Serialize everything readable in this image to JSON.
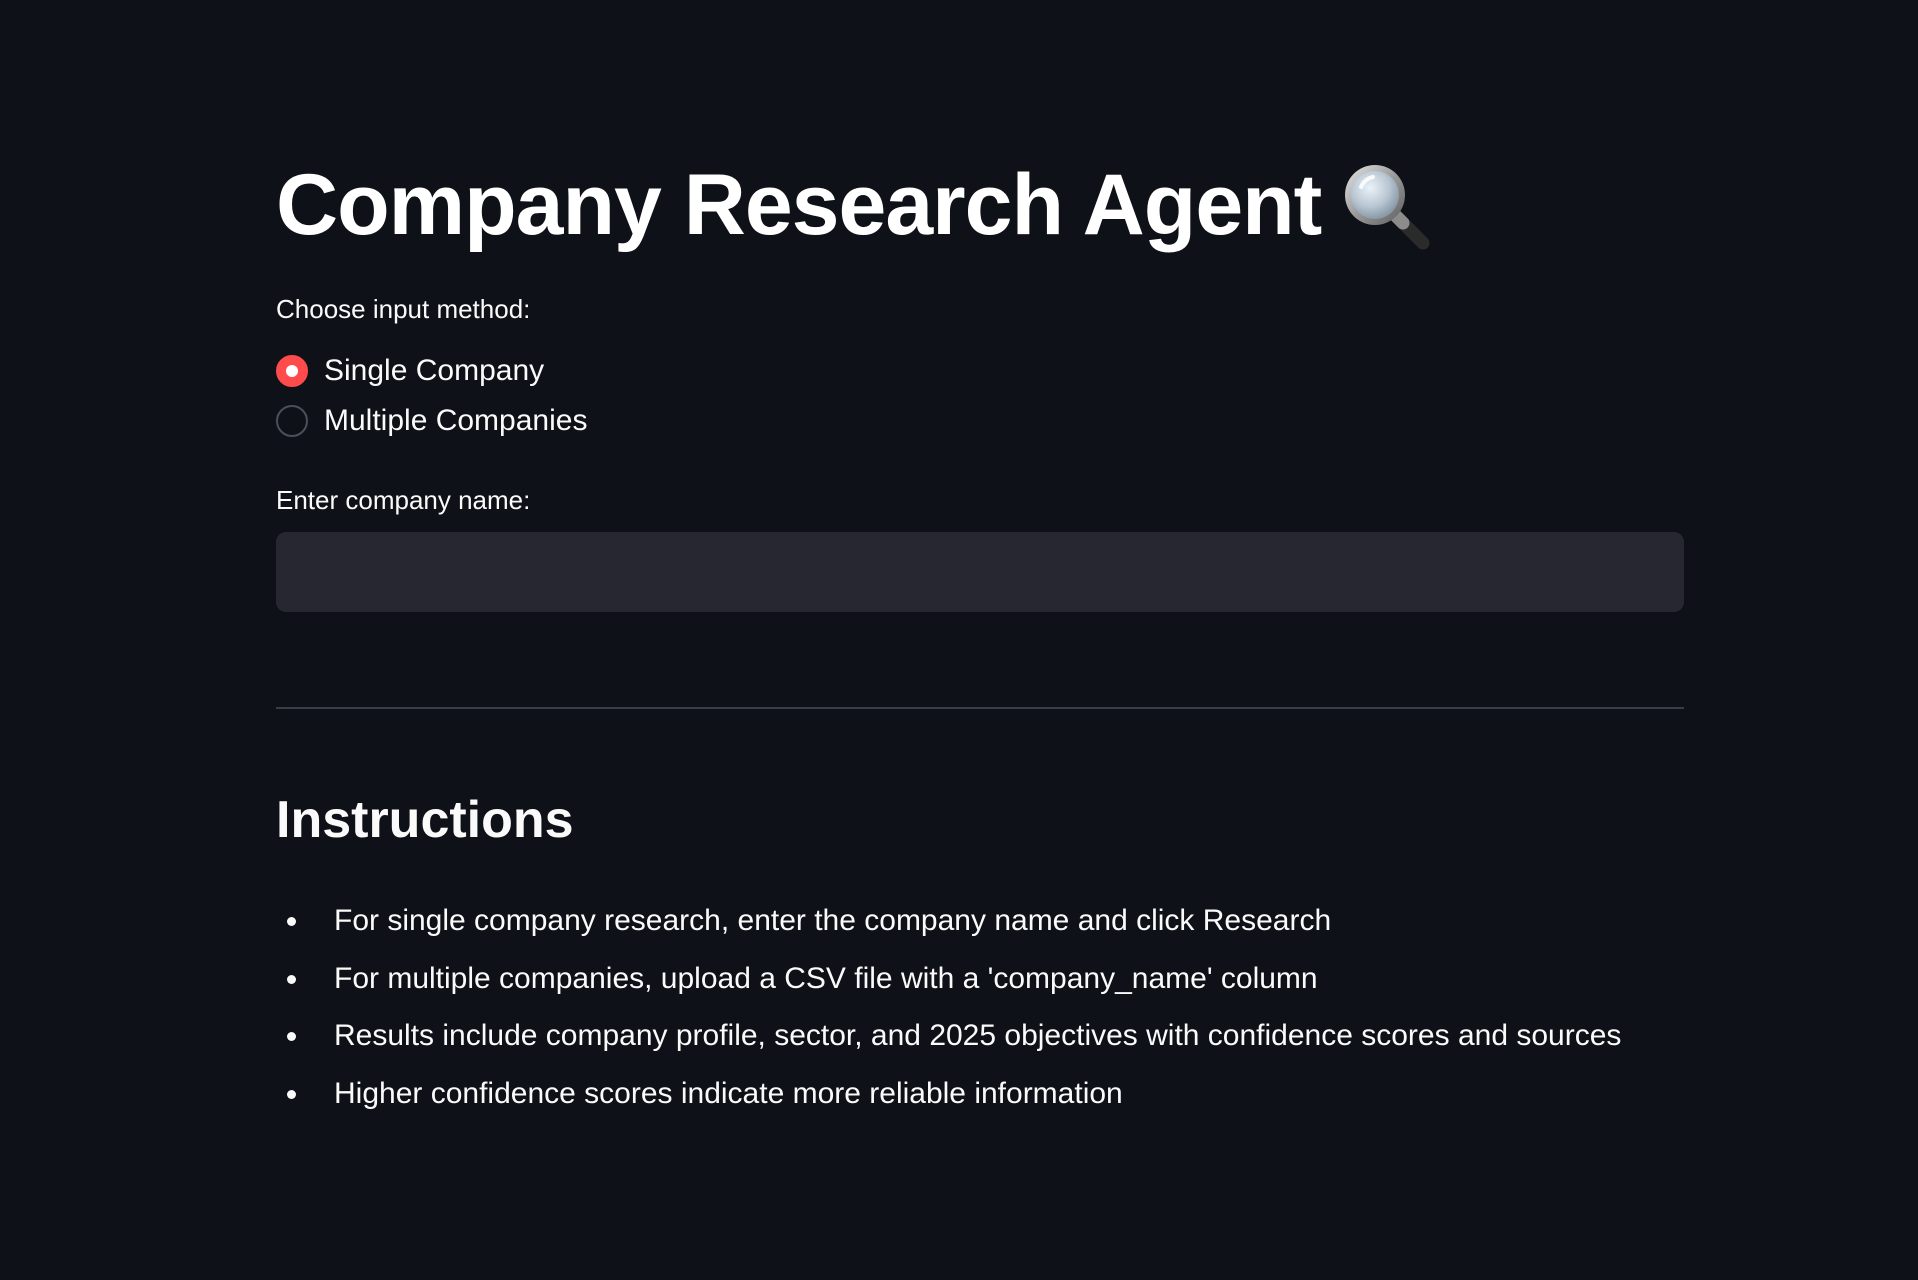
{
  "page": {
    "title": "Company Research Agent",
    "title_icon": "magnifying-glass-icon"
  },
  "input_method": {
    "label": "Choose input method:",
    "options": [
      "Single Company",
      "Multiple Companies"
    ],
    "selected": "Single Company"
  },
  "company_input": {
    "label": "Enter company name:",
    "value": "",
    "placeholder": ""
  },
  "instructions": {
    "heading": "Instructions",
    "items": [
      "For single company research, enter the company name and click Research",
      "For multiple companies, upload a CSV file with a 'company_name' column",
      "Results include company profile, sector, and 2025 objectives with confidence scores and sources",
      "Higher confidence scores indicate more reliable information"
    ]
  },
  "colors": {
    "background": "#0e1117",
    "accent": "#ff4b4b",
    "input_background": "#262730",
    "text": "#fafafa"
  }
}
